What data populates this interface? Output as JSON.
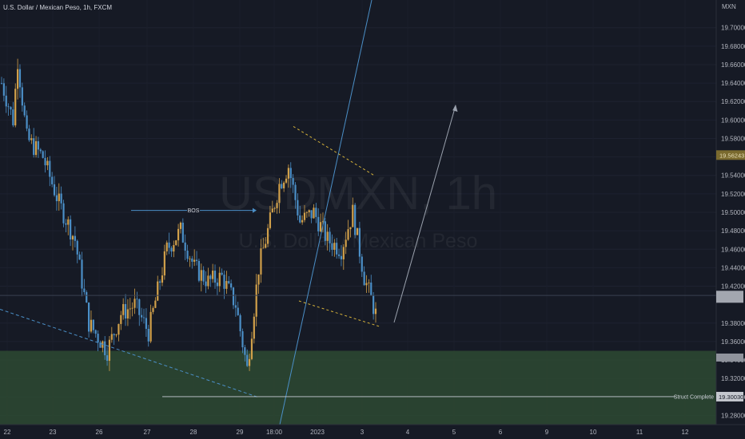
{
  "header": {
    "symbol_title": "U.S. Dollar / Mexican Peso, 1h, FXCM",
    "currency": "MXN"
  },
  "watermark": {
    "symbol": "USDMXN, 1h",
    "description": "U.S. Dollar / Mexican Peso"
  },
  "colors": {
    "background": "#161a25",
    "up_candle": "#d1a04a",
    "down_candle": "#4b8fc7",
    "demand_zone": "#2d4a33",
    "trendline": "#4b8fc7",
    "wedge_lines": "#d4b13a",
    "projection_arrow": "#9aa1ad",
    "price_tag": "#7a6a2e"
  },
  "chart_data": {
    "type": "candlestick",
    "symbol": "USDMXN",
    "interval": "1h",
    "ylim": [
      19.27,
      19.73
    ],
    "y_ticks": [
      "19.70000",
      "19.68000",
      "19.66000",
      "19.64000",
      "19.62000",
      "19.60000",
      "19.58000",
      "19.56000",
      "19.54000",
      "19.52000",
      "19.50000",
      "19.48000",
      "19.46000",
      "19.44000",
      "19.42000",
      "19.38000",
      "19.36000",
      "19.34000",
      "19.32000",
      "19.30000",
      "19.28000"
    ],
    "x_ticks": [
      "22",
      "23",
      "26",
      "27",
      "28",
      "29",
      "18:00",
      "2023",
      "3",
      "4",
      "5",
      "6",
      "9",
      "10",
      "11",
      "12"
    ],
    "price_tags": {
      "current_price": "19.56243",
      "struct_level": "19.30030"
    },
    "annotations": {
      "bos_label": "BOS",
      "struct_label": "Struct Complete"
    },
    "demand_zone": {
      "from": 19.27,
      "to": 19.35
    },
    "struct_level": 19.3003,
    "bos_level": 19.502,
    "horizontal_line": 19.41,
    "anchors": [
      {
        "i": 0,
        "v": 19.64
      },
      {
        "i": 5,
        "v": 19.6
      },
      {
        "i": 7,
        "v": 19.665
      },
      {
        "i": 11,
        "v": 19.58
      },
      {
        "i": 18,
        "v": 19.56
      },
      {
        "i": 25,
        "v": 19.51
      },
      {
        "i": 32,
        "v": 19.47
      },
      {
        "i": 38,
        "v": 19.38
      },
      {
        "i": 46,
        "v": 19.35
      },
      {
        "i": 52,
        "v": 19.39
      },
      {
        "i": 58,
        "v": 19.4
      },
      {
        "i": 64,
        "v": 19.37
      },
      {
        "i": 72,
        "v": 19.46
      },
      {
        "i": 78,
        "v": 19.48
      },
      {
        "i": 84,
        "v": 19.44
      },
      {
        "i": 90,
        "v": 19.425
      },
      {
        "i": 96,
        "v": 19.43
      },
      {
        "i": 102,
        "v": 19.4
      },
      {
        "i": 107,
        "v": 19.33
      },
      {
        "i": 112,
        "v": 19.44
      },
      {
        "i": 117,
        "v": 19.49
      },
      {
        "i": 121,
        "v": 19.53
      },
      {
        "i": 125,
        "v": 19.55
      },
      {
        "i": 130,
        "v": 19.49
      },
      {
        "i": 136,
        "v": 19.5
      },
      {
        "i": 142,
        "v": 19.47
      },
      {
        "i": 148,
        "v": 19.46
      },
      {
        "i": 153,
        "v": 19.5
      },
      {
        "i": 158,
        "v": 19.43
      },
      {
        "i": 163,
        "v": 19.39
      }
    ]
  }
}
